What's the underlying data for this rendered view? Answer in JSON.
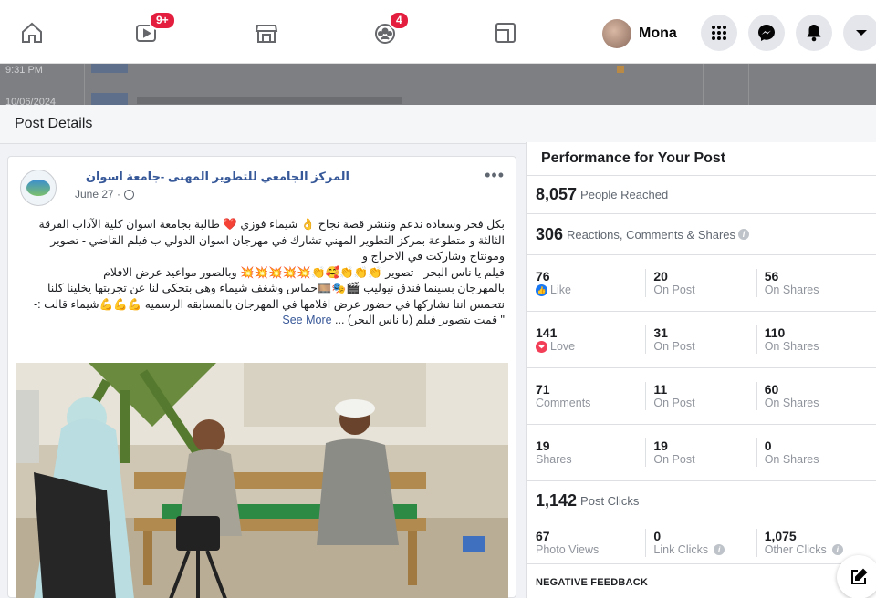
{
  "topnav": {
    "video_badge": "9+",
    "groups_badge": "4",
    "profile_name": "Mona"
  },
  "background": {
    "time_text": "9:31 PM",
    "date_text": "10/06/2024"
  },
  "modal": {
    "title": "Post Details"
  },
  "post": {
    "page_name": "المركز الجامعي للتطوير المهنى -جامعة اسوان",
    "date": "June 27 ·",
    "lines": [
      "بكل فخر وسعادة ندعم وننشر قصة نجاح 👌 شيماء فوزي ❤️ طالبة بجامعة اسوان كلية الآداب الفرقة",
      "الثالثة و متطوعة بمركز التطوير المهني تشارك في مهرجان اسوان الدولي ب فيلم القاضي - تصوير",
      "ومونتاج وشاركت في الاخراج و",
      "فيلم يا ناس البحر - تصوير 👏👏👏🥰👏💥💥💥💥💥 وبالصور مواعيد عرض الافلام",
      "بالمهرجان بسينما فندق نيوليب 🎬🎭🎞️حماس وشغف شيماء وهي بتحكي لنا عن تجربتها يخلينا كلنا",
      "نتحمس اننا نشاركها في حضور عرض افلامها في المهرجان بالمسابقه الرسميه 💪💪💪شيماء قالت :-"
    ],
    "last_line": "\" قمت بتصوير فيلم (يا ناس البحر) ...",
    "see_more": "See More"
  },
  "performance": {
    "title": "Performance for Your Post",
    "reached": {
      "value": "8,057",
      "label": "People Reached"
    },
    "engagement": {
      "value": "306",
      "label": "Reactions, Comments & Shares"
    },
    "rows": [
      {
        "total": "76",
        "total_label": "Like",
        "on_post": "20",
        "on_post_label": "On Post",
        "on_shares": "56",
        "on_shares_label": "On Shares"
      },
      {
        "total": "141",
        "total_label": "Love",
        "on_post": "31",
        "on_post_label": "On Post",
        "on_shares": "110",
        "on_shares_label": "On Shares"
      },
      {
        "total": "71",
        "total_label": "Comments",
        "on_post": "11",
        "on_post_label": "On Post",
        "on_shares": "60",
        "on_shares_label": "On Shares"
      },
      {
        "total": "19",
        "total_label": "Shares",
        "on_post": "19",
        "on_post_label": "On Post",
        "on_shares": "0",
        "on_shares_label": "On Shares"
      }
    ],
    "clicks": {
      "value": "1,142",
      "label": "Post Clicks"
    },
    "click_breakdown": [
      {
        "value": "67",
        "label": "Photo Views"
      },
      {
        "value": "0",
        "label": "Link Clicks"
      },
      {
        "value": "1,075",
        "label": "Other Clicks"
      }
    ],
    "negative_feedback": "NEGATIVE FEEDBACK"
  },
  "colors": {
    "like_blue": "#1877f2",
    "love_red": "#f33e58",
    "link_blue": "#365899",
    "badge_red": "#e41e3f"
  }
}
